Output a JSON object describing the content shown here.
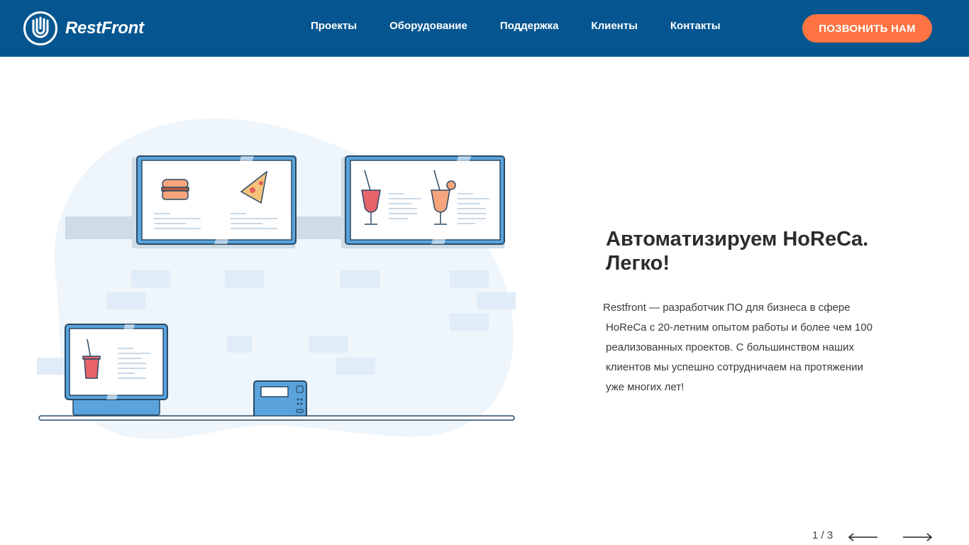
{
  "header": {
    "brand": "RestFront",
    "nav": [
      {
        "label": "Проекты"
      },
      {
        "label": "Оборудование"
      },
      {
        "label": "Поддержка"
      },
      {
        "label": "Клиенты"
      },
      {
        "label": "Контакты"
      }
    ],
    "call_label": "ПОЗВОНИТЬ НАМ"
  },
  "hero": {
    "title_line1": "Автоматизируем HoReCa.",
    "title_line2": "Легко!",
    "description_lines": [
      "Restfront — разработчик ПО для бизнеса в сфере",
      "HoReCa с 20-летним опытом работы и более чем 100",
      "реализованных проектов. С большинством наших",
      "клиентов мы успешно сотрудничаем на протяжении",
      "уже многих лет!"
    ]
  },
  "slider": {
    "current": "1",
    "separator": " / ",
    "total": "3"
  },
  "colors": {
    "header_bg": "#055690",
    "accent": "#ff7241",
    "illustration_blue": "#5aa3dc",
    "illustration_bg": "#eef5fb"
  }
}
